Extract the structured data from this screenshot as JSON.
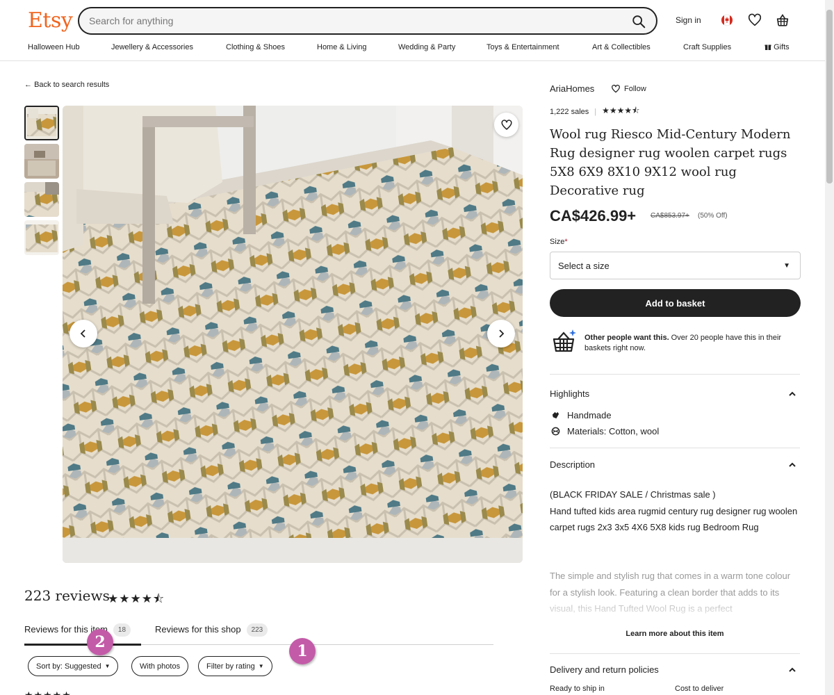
{
  "header": {
    "logo": "Etsy",
    "search_placeholder": "Search for anything",
    "signin": "Sign in",
    "nav": [
      "Halloween Hub",
      "Jewellery & Accessories",
      "Clothing & Shoes",
      "Home & Living",
      "Wedding & Party",
      "Toys & Entertainment",
      "Art & Collectibles",
      "Craft Supplies",
      "Gifts"
    ]
  },
  "gallery": {
    "back_label": "Back to search results"
  },
  "listing": {
    "shop_name": "AriaHomes",
    "follow_label": "Follow",
    "sales": "1,222 sales",
    "rating_stars": "★★★★⯪",
    "title": "Wool rug Riesco Mid-Century Modern Rug designer rug woolen carpet rugs 5X8 6X9 8X10 9X12 wool rug Decorative rug",
    "price": "CA$426.99+",
    "original_price": "CA$853.97+",
    "discount": "(50% Off)",
    "size_label": "Size",
    "size_required": "*",
    "size_placeholder": "Select a size",
    "add_to_basket": "Add to basket",
    "demand_bold": "Other people want this.",
    "demand_text": " Over 20 people have this in their baskets right now."
  },
  "highlights": {
    "heading": "Highlights",
    "items": [
      "Handmade",
      "Materials: Cotton, wool"
    ]
  },
  "description": {
    "heading": "Description",
    "line1": "(BLACK FRIDAY SALE / Christmas sale )",
    "body": "Hand tufted kids area rugmid century rug designer rug woolen carpet rugs 2x3 3x5 4X6 5X8 kids rug Bedroom Rug",
    "faded": "The simple and stylish rug that comes in a warm tone colour for a stylish look. Featuring a clean border that adds to its visual, this Hand Tufted Wool Rug is a perfect",
    "learn_more": "Learn more about this item"
  },
  "policies": {
    "heading": "Delivery and return policies",
    "ready": "Ready to ship in",
    "cost": "Cost to deliver"
  },
  "reviews": {
    "title": "223 reviews",
    "stars": "★★★★⯪",
    "tab_item": "Reviews for this item",
    "tab_item_count": "18",
    "tab_shop": "Reviews for this shop",
    "tab_shop_count": "223",
    "sort_label": "Sort by: Suggested",
    "photos_label": "With photos",
    "filter_label": "Filter by rating",
    "bottom_stars": "★★★★★"
  },
  "annotations": {
    "marker_1": "1",
    "marker_2": "2"
  },
  "colors": {
    "brand": "#F1641E",
    "text": "#222222",
    "marker": "#C35BA8",
    "button": "#222222"
  }
}
